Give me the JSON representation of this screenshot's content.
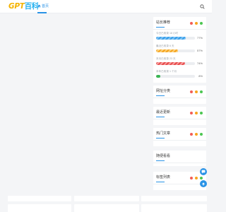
{
  "header": {
    "logo_en": "GPT",
    "logo_cn": "百科",
    "nav_home": "首页"
  },
  "stats_card": {
    "title": "站长推荐",
    "items": [
      {
        "label": "今日已收录 18 小时",
        "percent_text": "77%",
        "fill": 0.77,
        "color": "blue"
      },
      {
        "label": "最近已收录 6 天",
        "percent_text": "57%",
        "fill": 0.57,
        "color": "orange"
      },
      {
        "label": "本月已收录 23 天",
        "percent_text": "74%",
        "fill": 0.74,
        "color": "red"
      },
      {
        "label": "本年已收录 1 个月",
        "percent_text": "8%",
        "fill": 0.08,
        "color": "green"
      }
    ]
  },
  "sidebar_cards": [
    {
      "title": "网址分类"
    },
    {
      "title": "最近更新"
    },
    {
      "title": "热门文章"
    },
    {
      "title": "随便看看"
    },
    {
      "title": "标签列表"
    }
  ],
  "colors": {
    "accent": "#2a93e6",
    "logo_yellow": "#f4b300",
    "logo_blue": "#2bb3f0",
    "dot_red": "#f25d54",
    "dot_orange": "#f7a51d",
    "dot_green": "#4cc651"
  },
  "icons": [
    "home-icon",
    "search-icon",
    "chat-icon",
    "arrow-up-icon"
  ]
}
